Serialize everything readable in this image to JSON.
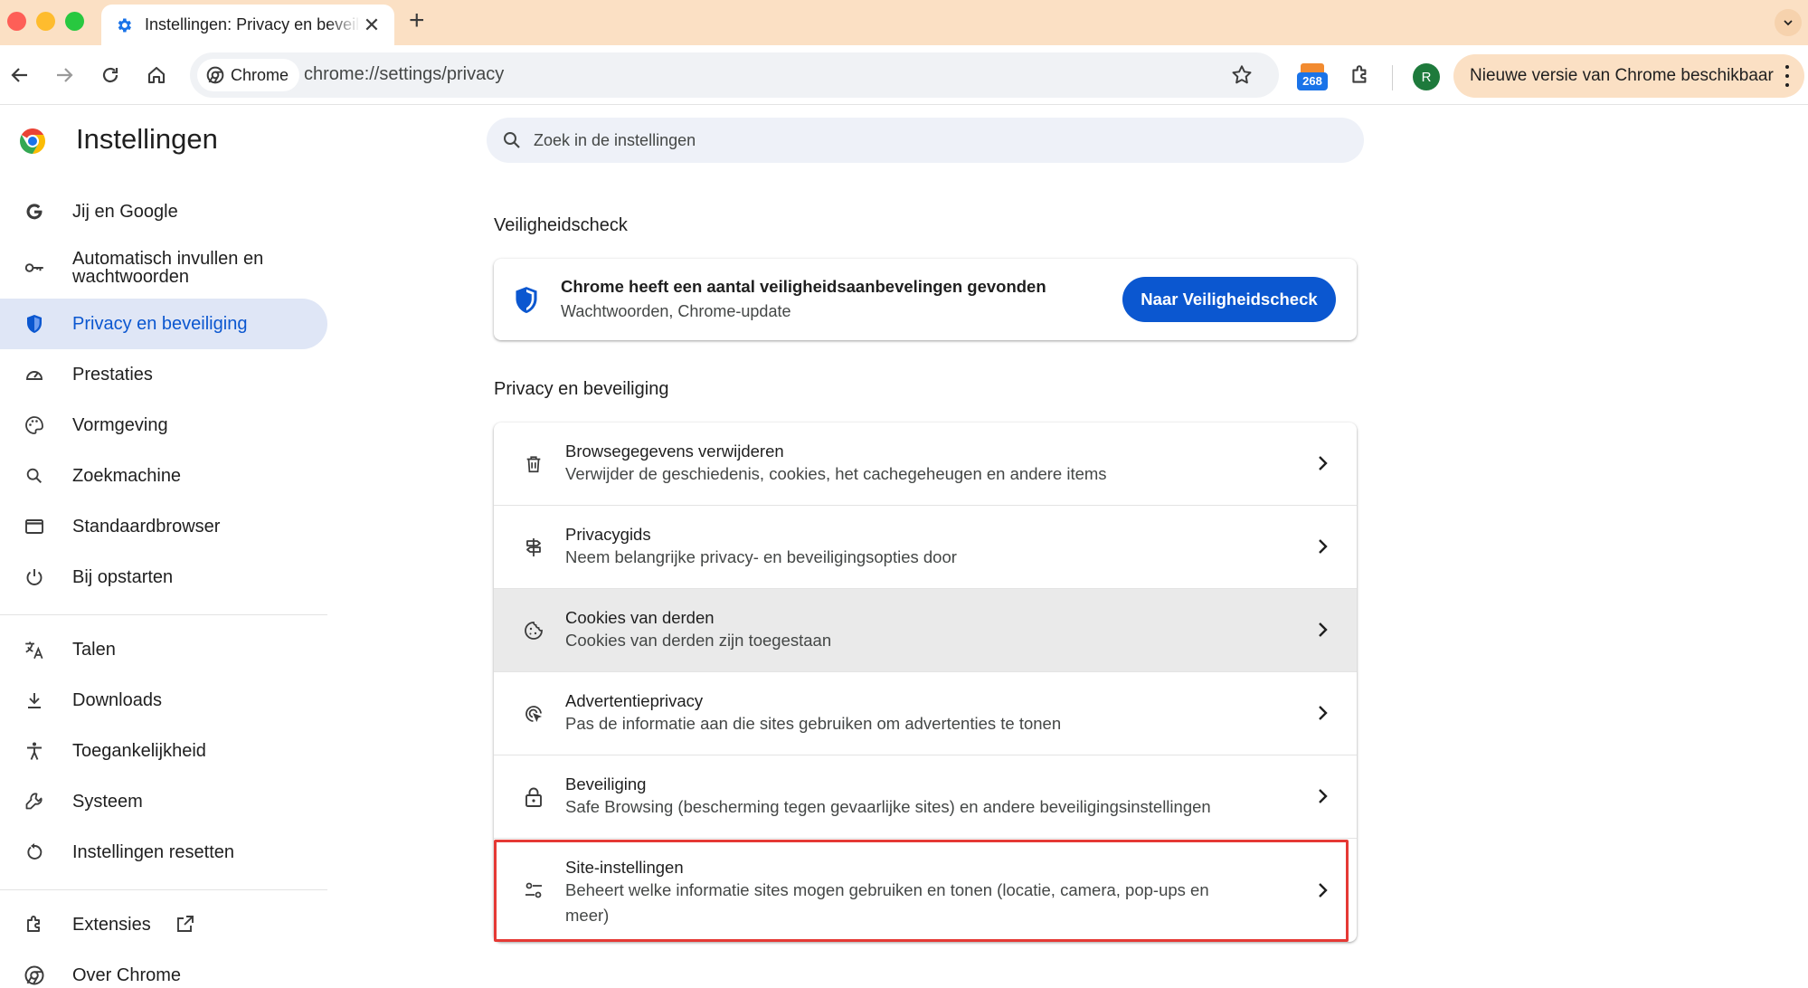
{
  "browser": {
    "tab_title": "Instellingen: Privacy en beveiliging",
    "chip_label": "Chrome",
    "url": "chrome://settings/privacy",
    "extension_badge": "268",
    "profile_initial": "R",
    "update_label": "Nieuwe versie van Chrome beschikbaar"
  },
  "sidebar": {
    "title": "Instellingen",
    "items": [
      {
        "label": "Jij en Google",
        "icon": "google-g-icon"
      },
      {
        "label": "Automatisch invullen en wachtwoorden",
        "icon": "key-icon"
      },
      {
        "label": "Privacy en beveiliging",
        "icon": "shield-icon",
        "active": true
      },
      {
        "label": "Prestaties",
        "icon": "speedometer-icon"
      },
      {
        "label": "Vormgeving",
        "icon": "palette-icon"
      },
      {
        "label": "Zoekmachine",
        "icon": "search-icon"
      },
      {
        "label": "Standaardbrowser",
        "icon": "browser-window-icon"
      },
      {
        "label": "Bij opstarten",
        "icon": "power-icon"
      },
      {
        "label": "Talen",
        "icon": "translate-icon"
      },
      {
        "label": "Downloads",
        "icon": "download-icon"
      },
      {
        "label": "Toegankelijkheid",
        "icon": "accessibility-icon"
      },
      {
        "label": "Systeem",
        "icon": "wrench-icon"
      },
      {
        "label": "Instellingen resetten",
        "icon": "reset-icon"
      },
      {
        "label": "Extensies",
        "icon": "puzzle-icon"
      },
      {
        "label": "Over Chrome",
        "icon": "chrome-icon"
      }
    ]
  },
  "search": {
    "placeholder": "Zoek in de instellingen"
  },
  "safety_check": {
    "heading": "Veiligheidscheck",
    "title": "Chrome heeft een aantal veiligheidsaanbevelingen gevonden",
    "subtitle": "Wachtwoorden, Chrome-update",
    "button": "Naar Veiligheidscheck"
  },
  "privacy": {
    "heading": "Privacy en beveiliging",
    "rows": [
      {
        "title": "Browsegegevens verwijderen",
        "subtitle": "Verwijder de geschiedenis, cookies, het cachegeheugen en andere items",
        "icon": "trash-icon"
      },
      {
        "title": "Privacygids",
        "subtitle": "Neem belangrijke privacy- en beveiligingsopties door",
        "icon": "signpost-icon"
      },
      {
        "title": "Cookies van derden",
        "subtitle": "Cookies van derden zijn toegestaan",
        "icon": "cookie-icon",
        "highlighted": true
      },
      {
        "title": "Advertentieprivacy",
        "subtitle": "Pas de informatie aan die sites gebruiken om advertenties te tonen",
        "icon": "ad-privacy-icon"
      },
      {
        "title": "Beveiliging",
        "subtitle": "Safe Browsing (bescherming tegen gevaarlijke sites) en andere beveiligingsinstellingen",
        "icon": "lock-icon"
      },
      {
        "title": "Site-instellingen",
        "subtitle": "Beheert welke informatie sites mogen gebruiken en tonen (locatie, camera, pop-ups en meer)",
        "icon": "tune-icon",
        "outlined": true
      }
    ]
  },
  "colors": {
    "accent": "#0b57d0",
    "active_nav_bg": "#dfe6f6",
    "titlebar_bg": "#fbe0c4",
    "outline": "#e53935"
  }
}
